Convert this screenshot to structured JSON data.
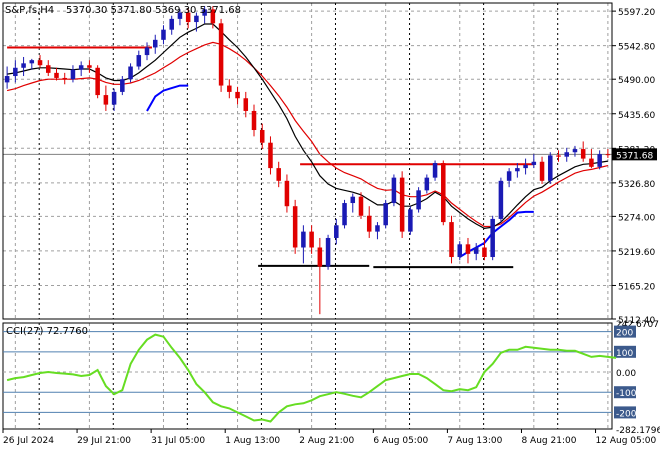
{
  "window": {
    "title": "S&P,fs,H4",
    "ohlc": "5370.30 5371.80 5369.30 5371.68"
  },
  "price_axis": {
    "ticks": [
      "5597.20",
      "5542.80",
      "5490.00",
      "5435.60",
      "5381.20",
      "5326.80",
      "5274.00",
      "5219.60",
      "5165.20",
      "5112.40"
    ],
    "current_price": "5371.68"
  },
  "indicator": {
    "label": "CCI(27) 72.7760",
    "ticks": [
      "242.6707",
      "200",
      "100",
      "0.00",
      "-100",
      "-200",
      "-282.1796"
    ]
  },
  "time_axis": {
    "labels": [
      "26 Jul 2024",
      "29 Jul 21:00",
      "31 Jul 05:00",
      "1 Aug 13:00",
      "2 Aug 21:00",
      "6 Aug 05:00",
      "7 Aug 13:00",
      "8 Aug 21:00",
      "12 Aug 05:00"
    ]
  },
  "colors": {
    "bull": "#1a1ab4",
    "bear": "#e00000",
    "ema_fast": "#000000",
    "ema_slow": "#e00000",
    "support_trend": "#0000ff",
    "cci": "#66dd22",
    "grid": "#a0a0a0",
    "price_tag": "#000000"
  },
  "chart_data": {
    "type": "candlestick",
    "price_range": [
      5112.4,
      5610
    ],
    "candles": [
      [
        5485,
        5510,
        5475,
        5495
      ],
      [
        5495,
        5520,
        5485,
        5508
      ],
      [
        5508,
        5525,
        5495,
        5515
      ],
      [
        5515,
        5522,
        5505,
        5520
      ],
      [
        5520,
        5528,
        5508,
        5512
      ],
      [
        5512,
        5520,
        5495,
        5500
      ],
      [
        5500,
        5508,
        5488,
        5492
      ],
      [
        5492,
        5500,
        5482,
        5490
      ],
      [
        5490,
        5512,
        5485,
        5505
      ],
      [
        5505,
        5518,
        5495,
        5512
      ],
      [
        5512,
        5520,
        5500,
        5508
      ],
      [
        5508,
        5512,
        5460,
        5465
      ],
      [
        5465,
        5480,
        5440,
        5450
      ],
      [
        5450,
        5475,
        5440,
        5470
      ],
      [
        5470,
        5495,
        5465,
        5490
      ],
      [
        5490,
        5515,
        5485,
        5510
      ],
      [
        5510,
        5535,
        5505,
        5528
      ],
      [
        5528,
        5548,
        5520,
        5540
      ],
      [
        5540,
        5560,
        5530,
        5552
      ],
      [
        5552,
        5575,
        5545,
        5568
      ],
      [
        5568,
        5590,
        5560,
        5585
      ],
      [
        5585,
        5600,
        5575,
        5595
      ],
      [
        5595,
        5602,
        5570,
        5580
      ],
      [
        5580,
        5595,
        5565,
        5590
      ],
      [
        5590,
        5605,
        5578,
        5600
      ],
      [
        5600,
        5605,
        5570,
        5578
      ],
      [
        5578,
        5585,
        5470,
        5480
      ],
      [
        5480,
        5490,
        5460,
        5470
      ],
      [
        5470,
        5478,
        5450,
        5460
      ],
      [
        5460,
        5470,
        5430,
        5440
      ],
      [
        5440,
        5450,
        5400,
        5410
      ],
      [
        5410,
        5420,
        5380,
        5390
      ],
      [
        5390,
        5400,
        5340,
        5350
      ],
      [
        5350,
        5360,
        5320,
        5330
      ],
      [
        5330,
        5340,
        5280,
        5290
      ],
      [
        5290,
        5300,
        5215,
        5225
      ],
      [
        5225,
        5260,
        5200,
        5250
      ],
      [
        5250,
        5260,
        5215,
        5225
      ],
      [
        5225,
        5240,
        5120,
        5195
      ],
      [
        5195,
        5245,
        5190,
        5240
      ],
      [
        5240,
        5270,
        5230,
        5260
      ],
      [
        5260,
        5300,
        5255,
        5295
      ],
      [
        5295,
        5310,
        5280,
        5305
      ],
      [
        5305,
        5312,
        5270,
        5275
      ],
      [
        5275,
        5290,
        5240,
        5250
      ],
      [
        5250,
        5265,
        5238,
        5260
      ],
      [
        5260,
        5300,
        5255,
        5295
      ],
      [
        5295,
        5340,
        5290,
        5335
      ],
      [
        5335,
        5345,
        5240,
        5250
      ],
      [
        5250,
        5290,
        5245,
        5285
      ],
      [
        5285,
        5320,
        5280,
        5315
      ],
      [
        5315,
        5340,
        5310,
        5335
      ],
      [
        5335,
        5362,
        5330,
        5358
      ],
      [
        5358,
        5362,
        5260,
        5265
      ],
      [
        5265,
        5275,
        5200,
        5210
      ],
      [
        5210,
        5235,
        5205,
        5230
      ],
      [
        5230,
        5240,
        5200,
        5215
      ],
      [
        5215,
        5232,
        5205,
        5225
      ],
      [
        5225,
        5240,
        5205,
        5210
      ],
      [
        5210,
        5275,
        5205,
        5270
      ],
      [
        5270,
        5335,
        5265,
        5330
      ],
      [
        5330,
        5350,
        5320,
        5345
      ],
      [
        5345,
        5358,
        5335,
        5350
      ],
      [
        5350,
        5365,
        5340,
        5355
      ],
      [
        5355,
        5372,
        5350,
        5360
      ],
      [
        5360,
        5368,
        5325,
        5330
      ],
      [
        5330,
        5375,
        5325,
        5370
      ],
      [
        5370,
        5378,
        5360,
        5368
      ],
      [
        5368,
        5382,
        5360,
        5375
      ],
      [
        5375,
        5385,
        5368,
        5380
      ],
      [
        5380,
        5392,
        5360,
        5365
      ],
      [
        5365,
        5380,
        5350,
        5352
      ],
      [
        5352,
        5378,
        5348,
        5372
      ],
      [
        5372,
        5380,
        5366,
        5371.68
      ]
    ],
    "ema_fast": [
      5498,
      5500,
      5503,
      5506,
      5508,
      5508,
      5507,
      5506,
      5505,
      5506,
      5506,
      5500,
      5492,
      5488,
      5488,
      5492,
      5500,
      5510,
      5520,
      5532,
      5544,
      5556,
      5564,
      5570,
      5577,
      5577,
      5565,
      5552,
      5540,
      5525,
      5508,
      5490,
      5470,
      5450,
      5428,
      5400,
      5378,
      5360,
      5338,
      5325,
      5318,
      5315,
      5312,
      5308,
      5300,
      5292,
      5292,
      5298,
      5290,
      5290,
      5295,
      5302,
      5312,
      5305,
      5290,
      5280,
      5270,
      5262,
      5255,
      5257,
      5265,
      5278,
      5292,
      5305,
      5316,
      5320,
      5330,
      5338,
      5345,
      5352,
      5356,
      5357,
      5359,
      5361
    ],
    "ema_slow": [
      5472,
      5475,
      5480,
      5484,
      5488,
      5490,
      5490,
      5490,
      5490,
      5491,
      5492,
      5490,
      5485,
      5482,
      5482,
      5484,
      5488,
      5494,
      5500,
      5508,
      5516,
      5525,
      5532,
      5538,
      5544,
      5548,
      5545,
      5538,
      5530,
      5520,
      5508,
      5495,
      5480,
      5464,
      5446,
      5425,
      5408,
      5392,
      5372,
      5360,
      5350,
      5343,
      5338,
      5333,
      5325,
      5318,
      5315,
      5316,
      5308,
      5305,
      5305,
      5308,
      5314,
      5308,
      5295,
      5285,
      5275,
      5266,
      5258,
      5258,
      5262,
      5272,
      5284,
      5296,
      5306,
      5312,
      5320,
      5328,
      5335,
      5342,
      5346,
      5348,
      5351,
      5354
    ],
    "support_trend": [
      [
        17,
        5440
      ],
      [
        18,
        5463
      ],
      [
        19,
        5472
      ],
      [
        20,
        5476
      ],
      [
        21,
        5480
      ],
      [
        22,
        5480
      ],
      null,
      [
        55,
        5210
      ],
      [
        56,
        5218
      ],
      [
        57,
        5225
      ],
      [
        58,
        5232
      ],
      [
        59,
        5248
      ],
      [
        60,
        5258
      ],
      [
        61,
        5268
      ],
      [
        62,
        5280
      ],
      [
        63,
        5281
      ],
      [
        64,
        5281
      ]
    ],
    "resistance_lines": [
      {
        "from": [
          0,
          5540
        ],
        "to": [
          17.6,
          5540
        ]
      },
      {
        "from": [
          35.6,
          5356
        ],
        "to": [
          64,
          5356
        ]
      }
    ],
    "support_lines": [
      {
        "from": [
          30.5,
          5196
        ],
        "to": [
          44,
          5196
        ]
      },
      {
        "from": [
          44.5,
          5194
        ],
        "to": [
          61.5,
          5194
        ]
      }
    ],
    "cci": {
      "range": [
        -282.1796,
        242.6707
      ],
      "levels": [
        200,
        100,
        0,
        -100,
        -200
      ],
      "values": [
        -40,
        -30,
        -25,
        -15,
        -5,
        0,
        -5,
        -8,
        -12,
        -20,
        -15,
        10,
        -70,
        -110,
        -90,
        40,
        110,
        160,
        185,
        175,
        120,
        70,
        10,
        -60,
        -100,
        -150,
        -170,
        -180,
        -200,
        -220,
        -240,
        -235,
        -245,
        -200,
        -170,
        -160,
        -155,
        -140,
        -120,
        -110,
        -100,
        -108,
        -118,
        -125,
        -100,
        -70,
        -40,
        -30,
        -20,
        -10,
        -10,
        -30,
        -60,
        -90,
        -95,
        -85,
        -90,
        -75,
        0,
        40,
        95,
        110,
        110,
        125,
        120,
        115,
        110,
        110,
        105,
        105,
        90,
        75,
        80,
        75,
        70
      ]
    }
  }
}
